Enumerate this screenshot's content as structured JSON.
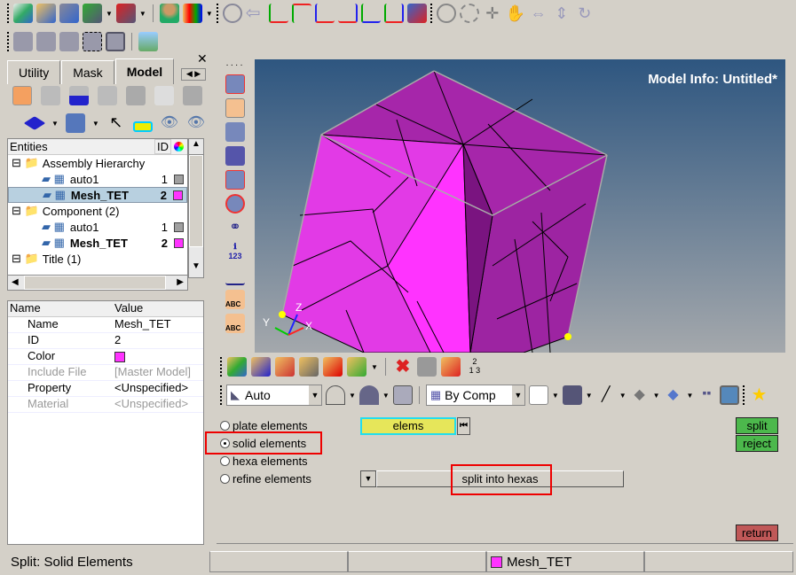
{
  "toolbar_top": {
    "icons": [
      "new-model-icon",
      "open-model-icon",
      "save-model-icon",
      "import-icon",
      "export-icon",
      "user-profile-icon",
      "open-results-icon",
      "zoom-icon",
      "previous-view-icon",
      "view-xy-top-icon",
      "view-xy-bottom-icon",
      "view-xz-left-icon",
      "view-xz-right-icon",
      "view-yz-icon",
      "view-iso-icon",
      "view-3d-icon",
      "zoom-window-icon",
      "fit-icon",
      "pan-icon",
      "rotate-hand-icon",
      "spin-x-icon",
      "spin-y-icon",
      "spin-z-icon"
    ]
  },
  "toolbar_second": {
    "icons": [
      "save-view-icon",
      "restore-view-icon",
      "view-list-icon",
      "view-window-icon",
      "view-frame-icon",
      "capture-image-icon"
    ]
  },
  "browser": {
    "tabs": [
      {
        "label": "Utility"
      },
      {
        "label": "Mask"
      },
      {
        "label": "Model",
        "active": true
      }
    ],
    "tree_header": {
      "label": "Entities",
      "id_label": "ID"
    },
    "tree": [
      {
        "label": "Assembly Hierarchy",
        "level": 0
      },
      {
        "label": "auto1",
        "id": "1",
        "color": "#a0a0a0",
        "level": 1
      },
      {
        "label": "Mesh_TET",
        "id": "2",
        "color": "#ff33ff",
        "level": 1,
        "bold": true,
        "selected": true
      },
      {
        "label": "Component (2)",
        "level": 0
      },
      {
        "label": "auto1",
        "id": "1",
        "color": "#a0a0a0",
        "level": 1
      },
      {
        "label": "Mesh_TET",
        "id": "2",
        "color": "#ff33ff",
        "level": 1,
        "bold": true
      },
      {
        "label": "Title (1)",
        "level": 0
      }
    ],
    "props_header": {
      "name": "Name",
      "value": "Value"
    },
    "props": [
      {
        "name": "Name",
        "value": "Mesh_TET"
      },
      {
        "name": "ID",
        "value": "2"
      },
      {
        "name": "Color",
        "value": "",
        "swatch": "#ff33ff"
      },
      {
        "name": "Include File",
        "value": "[Master Model]",
        "muted": true
      },
      {
        "name": "Property",
        "value": "<Unspecified>"
      },
      {
        "name": "Material",
        "value": "<Unspecified>",
        "muted": true
      }
    ]
  },
  "viewport": {
    "title": "Model Info: Untitled*",
    "axis": {
      "x": "X",
      "y": "Y",
      "z": "Z"
    },
    "mesh_color": "#ff33ff"
  },
  "panel": {
    "auto_label": "Auto",
    "bycomp_label": "By Comp",
    "options": [
      {
        "label": "plate elements"
      },
      {
        "label": "solid elements",
        "selected": true
      },
      {
        "label": "hexa elements"
      },
      {
        "label": "refine elements"
      }
    ],
    "elems_label": "elems",
    "method_label": "split into hexas",
    "split_label": "split",
    "reject_label": "reject",
    "return_label": "return"
  },
  "statusbar": {
    "message": "Split: Solid Elements",
    "component": "Mesh_TET",
    "component_color": "#ff33ff"
  }
}
